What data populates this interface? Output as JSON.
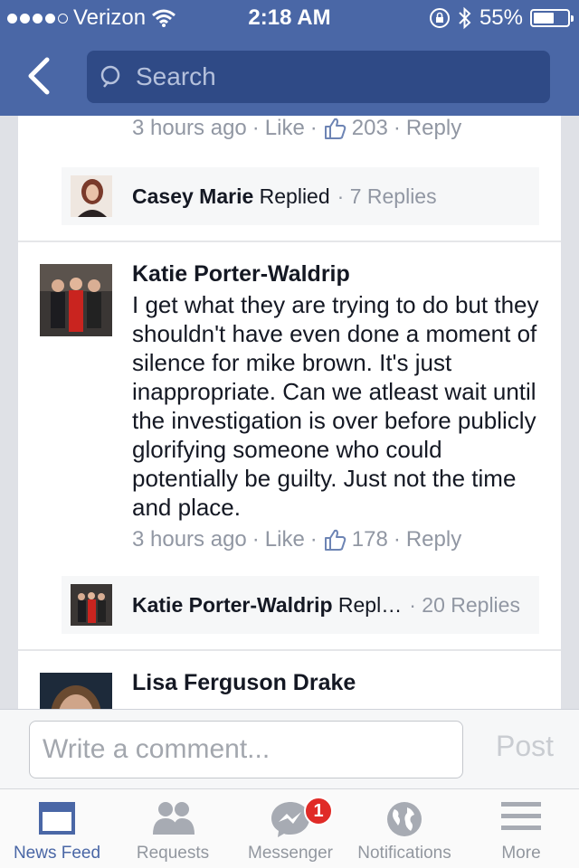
{
  "status_bar": {
    "carrier": "Verizon",
    "time": "2:18 AM",
    "battery": "55%",
    "battery_level": 0.55
  },
  "nav": {
    "search_placeholder": "Search"
  },
  "comments": [
    {
      "time": "3 hours ago",
      "like_label": "Like",
      "likes": "203",
      "reply_label": "Reply",
      "reply_author": "Casey Marie",
      "reply_action": "Replied",
      "reply_count": "7 Replies"
    },
    {
      "author": "Katie Porter-Waldrip",
      "text": "I get what they are trying to do but they shouldn't have even done a moment of silence for mike brown. It's just inappropriate. Can we atleast wait until the investigation is over before publicly glorifying someone who could potentially be guilty. Just not the time and place.",
      "time": "3 hours ago",
      "like_label": "Like",
      "likes": "178",
      "reply_label": "Reply",
      "reply_author": "Katie Porter-Waldrip",
      "reply_action": "Repl…",
      "reply_count": "20 Replies"
    },
    {
      "author": "Lisa Ferguson Drake"
    }
  ],
  "composer": {
    "placeholder": "Write a comment...",
    "post_label": "Post"
  },
  "tabs": [
    {
      "label": "News Feed",
      "icon": "news-feed-icon",
      "active": true
    },
    {
      "label": "Requests",
      "icon": "friend-requests-icon"
    },
    {
      "label": "Messenger",
      "icon": "messenger-icon",
      "badge": "1"
    },
    {
      "label": "Notifications",
      "icon": "globe-icon"
    },
    {
      "label": "More",
      "icon": "menu-icon"
    }
  ],
  "colors": {
    "brand": "#4a67a6",
    "badge": "#e02b27"
  }
}
